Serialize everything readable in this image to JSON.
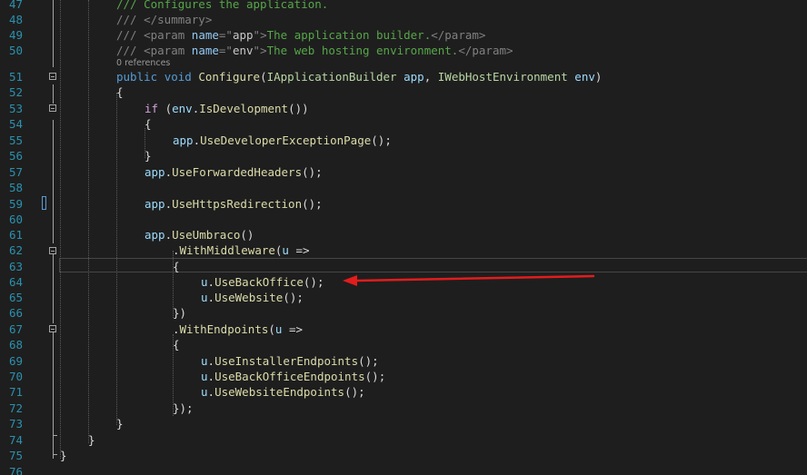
{
  "editor": {
    "lines": [
      {
        "n": "47",
        "tokens": [
          [
            "comment",
            "/// Configures the application."
          ]
        ]
      },
      {
        "n": "48",
        "tokens": [
          [
            "gray",
            "/// </summary>"
          ]
        ]
      },
      {
        "n": "49",
        "tokens": [
          [
            "gray",
            "/// <param "
          ],
          [
            "xmlname",
            "name"
          ],
          [
            "gray",
            "=\""
          ],
          [
            "xmlstr",
            "app"
          ],
          [
            "gray",
            "\">"
          ],
          [
            "comment",
            "The application builder."
          ],
          [
            "gray",
            "</param>"
          ]
        ]
      },
      {
        "n": "50",
        "tokens": [
          [
            "gray",
            "/// <param "
          ],
          [
            "xmlname",
            "name"
          ],
          [
            "gray",
            "=\""
          ],
          [
            "xmlstr",
            "env"
          ],
          [
            "gray",
            "\">"
          ],
          [
            "comment",
            "The web hosting environment."
          ],
          [
            "gray",
            "</param>"
          ]
        ]
      },
      {
        "n": "51",
        "tokens": [
          [
            "kw",
            "public"
          ],
          [
            "punct",
            " "
          ],
          [
            "kw",
            "void"
          ],
          [
            "punct",
            " "
          ],
          [
            "method",
            "Configure"
          ],
          [
            "punct",
            "("
          ],
          [
            "type",
            "IApplicationBuilder"
          ],
          [
            "punct",
            " "
          ],
          [
            "param",
            "app"
          ],
          [
            "punct",
            ", "
          ],
          [
            "type",
            "IWebHostEnvironment"
          ],
          [
            "punct",
            " "
          ],
          [
            "param",
            "env"
          ],
          [
            "punct",
            ")"
          ]
        ]
      },
      {
        "n": "52",
        "tokens": [
          [
            "punct",
            "{"
          ]
        ]
      },
      {
        "n": "53",
        "tokens": [
          [
            "ctrl",
            "if"
          ],
          [
            "punct",
            " ("
          ],
          [
            "param",
            "env"
          ],
          [
            "punct",
            "."
          ],
          [
            "method",
            "IsDevelopment"
          ],
          [
            "punct",
            "())"
          ]
        ]
      },
      {
        "n": "54",
        "tokens": [
          [
            "punct",
            "{"
          ]
        ]
      },
      {
        "n": "55",
        "tokens": [
          [
            "param",
            "app"
          ],
          [
            "punct",
            "."
          ],
          [
            "method",
            "UseDeveloperExceptionPage"
          ],
          [
            "punct",
            "();"
          ]
        ]
      },
      {
        "n": "56",
        "tokens": [
          [
            "punct",
            "}"
          ]
        ]
      },
      {
        "n": "57",
        "tokens": [
          [
            "param",
            "app"
          ],
          [
            "punct",
            "."
          ],
          [
            "method",
            "UseForwardedHeaders"
          ],
          [
            "punct",
            "();"
          ]
        ]
      },
      {
        "n": "58",
        "tokens": []
      },
      {
        "n": "59",
        "tokens": [
          [
            "param",
            "app"
          ],
          [
            "punct",
            "."
          ],
          [
            "method",
            "UseHttpsRedirection"
          ],
          [
            "punct",
            "();"
          ]
        ]
      },
      {
        "n": "60",
        "tokens": []
      },
      {
        "n": "61",
        "tokens": [
          [
            "param",
            "app"
          ],
          [
            "punct",
            "."
          ],
          [
            "method",
            "UseUmbraco"
          ],
          [
            "punct",
            "()"
          ]
        ]
      },
      {
        "n": "62",
        "tokens": [
          [
            "punct",
            "."
          ],
          [
            "method",
            "WithMiddleware"
          ],
          [
            "punct",
            "("
          ],
          [
            "param",
            "u"
          ],
          [
            "punct",
            " =>"
          ]
        ]
      },
      {
        "n": "63",
        "tokens": [
          [
            "punct",
            "{"
          ]
        ]
      },
      {
        "n": "64",
        "tokens": [
          [
            "param",
            "u"
          ],
          [
            "punct",
            "."
          ],
          [
            "method",
            "UseBackOffice"
          ],
          [
            "punct",
            "();"
          ]
        ]
      },
      {
        "n": "65",
        "tokens": [
          [
            "param",
            "u"
          ],
          [
            "punct",
            "."
          ],
          [
            "method",
            "UseWebsite"
          ],
          [
            "punct",
            "();"
          ]
        ]
      },
      {
        "n": "66",
        "tokens": [
          [
            "punct",
            "})"
          ]
        ]
      },
      {
        "n": "67",
        "tokens": [
          [
            "punct",
            "."
          ],
          [
            "method",
            "WithEndpoints"
          ],
          [
            "punct",
            "("
          ],
          [
            "param",
            "u"
          ],
          [
            "punct",
            " =>"
          ]
        ]
      },
      {
        "n": "68",
        "tokens": [
          [
            "punct",
            "{"
          ]
        ]
      },
      {
        "n": "69",
        "tokens": [
          [
            "param",
            "u"
          ],
          [
            "punct",
            "."
          ],
          [
            "method",
            "UseInstallerEndpoints"
          ],
          [
            "punct",
            "();"
          ]
        ]
      },
      {
        "n": "70",
        "tokens": [
          [
            "param",
            "u"
          ],
          [
            "punct",
            "."
          ],
          [
            "method",
            "UseBackOfficeEndpoints"
          ],
          [
            "punct",
            "();"
          ]
        ]
      },
      {
        "n": "71",
        "tokens": [
          [
            "param",
            "u"
          ],
          [
            "punct",
            "."
          ],
          [
            "method",
            "UseWebsiteEndpoints"
          ],
          [
            "punct",
            "();"
          ]
        ]
      },
      {
        "n": "72",
        "tokens": [
          [
            "punct",
            "});"
          ]
        ]
      },
      {
        "n": "73",
        "tokens": [
          [
            "punct",
            "}"
          ]
        ]
      },
      {
        "n": "74",
        "tokens": [
          [
            "punct",
            "}"
          ]
        ]
      },
      {
        "n": "75",
        "tokens": [
          [
            "punct",
            "}"
          ]
        ]
      },
      {
        "n": "76",
        "tokens": []
      }
    ],
    "codelens_text": "0 references"
  },
  "colors": {
    "background": "#1e1e1e",
    "line_number": "#2b91af",
    "arrow": "#e31c1c"
  }
}
